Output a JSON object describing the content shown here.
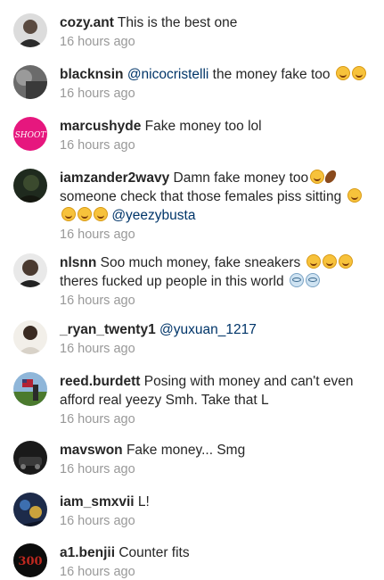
{
  "comments": [
    {
      "username": "cozy.ant",
      "text": "This is the best one",
      "time": "16 hours ago"
    },
    {
      "username": "blacknsin",
      "mention": "@nicocristelli",
      "text": " the money fake too",
      "time": "16 hours ago"
    },
    {
      "username": "marcushyde",
      "text": "Fake money too lol",
      "time": "16 hours ago",
      "avatar_text": "SHOOT"
    },
    {
      "username": "iamzander2wavy",
      "text": "Damn fake money too",
      "text2": " someone check that those females piss sitting ",
      "mention": "@yeezybusta",
      "time": "16 hours ago"
    },
    {
      "username": "nlsnn",
      "text": "Soo much money, fake sneakers ",
      "text2": " theres fucked up people in this world ",
      "time": "16 hours ago"
    },
    {
      "username": "_ryan_twenty1",
      "mention": "@yuxuan_1217",
      "time": "16 hours ago"
    },
    {
      "username": "reed.burdett",
      "text": "Posing with money and can't even afford real yeezy  Smh.  Take that L",
      "time": "16 hours ago"
    },
    {
      "username": "mavswon",
      "text": "Fake money... Smg",
      "time": "16 hours ago"
    },
    {
      "username": "iam_smxvii",
      "text": "L!",
      "time": "16 hours ago"
    },
    {
      "username": "a1.benjii",
      "text": "Counter fits",
      "time": "16 hours ago",
      "avatar_text": "300"
    }
  ],
  "colors": {
    "link": "#003569",
    "meta": "#999999",
    "text": "#262626",
    "emoji": "#f7c23b"
  },
  "emoji": {
    "laughing": "laughing-face-emoji",
    "football": "football-emoji",
    "flushed": "flushed-face-emoji"
  }
}
